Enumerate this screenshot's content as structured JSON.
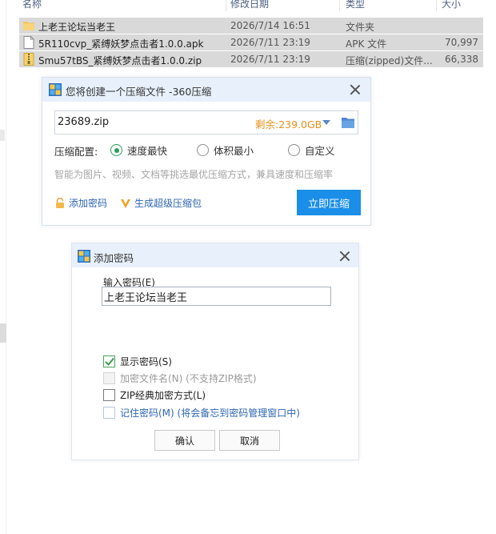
{
  "explorer": {
    "columns": {
      "name": "名称",
      "date": "修改日期",
      "type": "类型",
      "size": "大小"
    },
    "files": [
      {
        "name": "上老王论坛当老王",
        "date": "2026/7/14 16:51",
        "type": "文件夹",
        "size": "",
        "icon": "folder-icon"
      },
      {
        "name": "5R110cvp_紧缚妖梦点击者1.0.0.apk",
        "date": "2026/7/11 23:19",
        "type": "APK 文件",
        "size": "70,997",
        "icon": "apk-file-icon"
      },
      {
        "name": "Smu57tBS_紧缚妖梦点击者1.0.0.zip",
        "date": "2026/7/11 23:19",
        "type": "压缩(zipped)文件...",
        "size": "66,338",
        "icon": "zip-file-icon"
      }
    ]
  },
  "compress_dialog": {
    "title": "您将创建一个压缩文件 -360压缩",
    "filename": "23689.zip",
    "remaining": "剩余:239.0GB",
    "config_label": "压缩配置:",
    "options": [
      {
        "label": "速度最快",
        "selected": true
      },
      {
        "label": "体积最小",
        "selected": false
      },
      {
        "label": "自定义",
        "selected": false
      }
    ],
    "hint": "智能为图片、视频、文档等挑选最优压缩方式，兼具速度和压缩率",
    "add_password": "添加密码",
    "super_package": "生成超级压缩包",
    "compress_button": "立即压缩"
  },
  "password_dialog": {
    "title": "添加密码",
    "input_label": "输入密码(E)",
    "password_value": "上老王论坛当老王",
    "checkboxes": [
      {
        "label": "显示密码(S)",
        "checked": true,
        "disabled": false
      },
      {
        "label": "加密文件名(N) (不支持ZIP格式)",
        "checked": false,
        "disabled": true
      },
      {
        "label": "ZIP经典加密方式(L)",
        "checked": false,
        "disabled": false
      },
      {
        "label": "记住密码(M) (将会备忘到密码管理窗口中)",
        "checked": false,
        "disabled": false
      }
    ],
    "ok_button": "确认",
    "cancel_button": "取消"
  },
  "colors": {
    "accent_blue": "#1a8ee8",
    "remaining_orange": "#e69018",
    "link_blue": "#2d66b3",
    "radio_green": "#2b9c5c"
  }
}
